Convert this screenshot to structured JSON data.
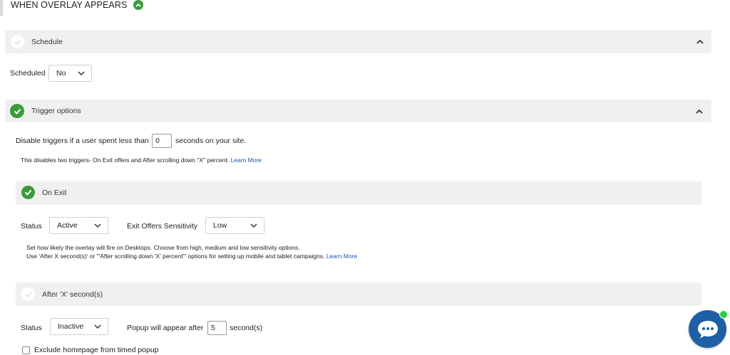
{
  "header": {
    "title": "WHEN OVERLAY APPEARS"
  },
  "schedule": {
    "title": "Schedule",
    "scheduled_label": "Scheduled",
    "scheduled_value": "No"
  },
  "trigger": {
    "title": "Trigger options",
    "disable_prefix": "Disable triggers if a user spent less than",
    "disable_value": "0",
    "disable_suffix": "seconds on your site.",
    "note": "This disables two triggers- On Exit offers and After scrolling down \"X\" percent.",
    "note_link": "Learn More"
  },
  "on_exit": {
    "title": "On Exit",
    "status_label": "Status",
    "status_value": "Active",
    "sensitivity_label": "Exit Offers Sensitivity",
    "sensitivity_value": "Low",
    "help_line1": "Set how likely the overlay will fire on Desktops. Choose from high, medium and low sensitivity options.",
    "help_line2": "Use 'After X second(s)' or '\"After scrolling down 'X' percent\"' options for setting up mobile and tablet campaigns.",
    "help_link": "Learn More"
  },
  "after_x": {
    "title": "After 'X' second(s)",
    "status_label": "Status",
    "status_value": "Inactive",
    "appear_label": "Popup will appear after",
    "appear_value": "5",
    "appear_suffix": "second(s)",
    "exclude_label": "Exclude homepage from timed popup"
  },
  "colors": {
    "accent_green": "#3a9b3a",
    "link_blue": "#1a55b4",
    "chat_blue": "#1e5fa5"
  }
}
